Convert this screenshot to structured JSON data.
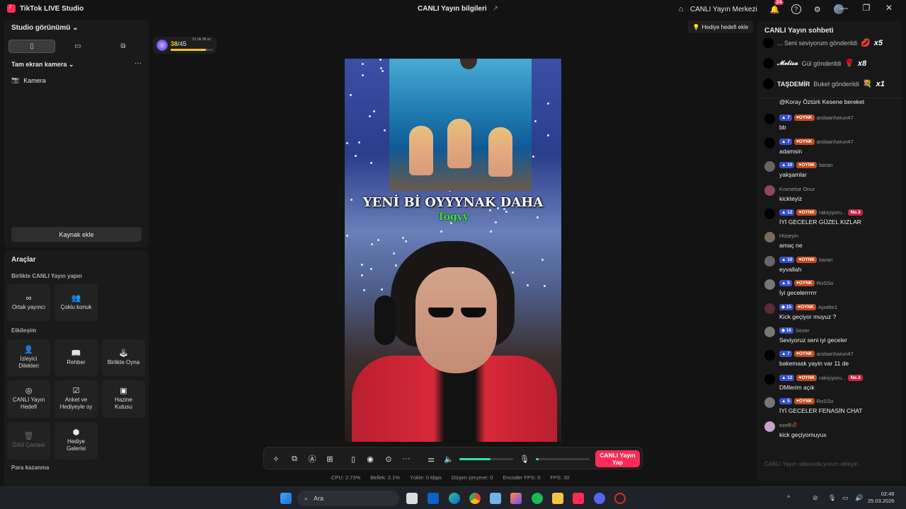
{
  "app": {
    "title": "TikTok LIVE Studio",
    "center_title": "CANLI Yayın bilgileri",
    "center_share_icon": "↗",
    "live_center": "CANLI Yayın Merkezi",
    "notification_count": "24",
    "help_glyph": "?",
    "window_min": "—",
    "window_max": "❐",
    "window_close": "✕"
  },
  "left": {
    "studio_view": "Studio görünümü",
    "camera_section": "Tam ekran kamera",
    "camera_item": "Kamera",
    "add_source": "Kaynak ekle"
  },
  "tools": {
    "title": "Araçlar",
    "sect_live_together": "Birlikte CANLI Yayın yapın",
    "co_host": "Ortak yayıncı",
    "multi_guest": "Çoklu konuk",
    "sect_interaction": "Etkileşim",
    "viewer_wishes": "İzleyici Dilekleri",
    "guide": "Rehber",
    "play_together": "Birlikte Oyna",
    "live_goal": "CANLI Yayın Hedefi",
    "poll": "Anket ve Hediyeyle oy",
    "treasure": "Hazine Kutusu",
    "reward_bag": "Ödül Çantası",
    "gift_gallery": "Hediye Galerisi",
    "sect_monetize": "Para kazanma"
  },
  "goal": {
    "current": "38",
    "total": "/45",
    "time": "51 dk 38 sn",
    "progress": 0.84
  },
  "gift_goal": "Hediye hedefi ekle",
  "preview": {
    "line1": "YENİ Bİ OYYYNAK DAHA",
    "line2": "Togyy"
  },
  "controls": {
    "volume_level": 0.58,
    "mic_level": 0.05,
    "go_live": "CANLI Yayın Yap"
  },
  "stats": {
    "cpu": "CPU:  2.73%",
    "mem": "Bellek:  2.1%",
    "upload": "Yükle:  0 kbps",
    "dropped": "Düşen çerçeve:  0",
    "encoder": "Encoder FPS:  0",
    "fps": "FPS:  30"
  },
  "chat": {
    "title": "CANLI Yayın sohbeti",
    "input_placeholder": "CANLI Yayın odasında yorum ekleyin",
    "gifts": [
      {
        "user": "",
        "action": "... Seni seviyorum gönderildi",
        "icon": "💋",
        "mult": "x5"
      },
      {
        "user": "𝓜𝓮𝓵𝓲𝓼𝓪",
        "action": "Gül gönderildi",
        "icon": "🌹",
        "mult": "x8"
      },
      {
        "user": "TAŞDEMİR",
        "action": "Buket gönderildi",
        "icon": "💐",
        "mult": "x1"
      }
    ],
    "messages": [
      {
        "user": "",
        "level": "",
        "fan": "",
        "rank": "",
        "text": "@Koray Öztürk Kesene bereket"
      },
      {
        "user": "arslaanharun47",
        "level": "▲ 7",
        "fan": "♥OYNK",
        "rank": "",
        "text": "bb"
      },
      {
        "user": "arslaanharun47",
        "level": "▲ 7",
        "fan": "♥OYNK",
        "rank": "",
        "text": "adamsin"
      },
      {
        "user": "baran",
        "level": "▲ 10",
        "fan": "♥OYNK",
        "rank": "",
        "text": "yakşamlar"
      },
      {
        "user": "Kısmetse Onur",
        "level": "",
        "fan": "",
        "rank": "",
        "text": "kickteyiz"
      },
      {
        "user": "rakiçiyoru...",
        "level": "▲ 12",
        "fan": "♥OYNK",
        "rank": "No.3",
        "text": "İYİ GECELER GÜZEL KIZLAR"
      },
      {
        "user": "Hüseyin",
        "level": "",
        "fan": "",
        "rank": "",
        "text": "amaç ne"
      },
      {
        "user": "baran",
        "level": "▲ 10",
        "fan": "♥OYNK",
        "rank": "",
        "text": "eyvallah"
      },
      {
        "user": "RoSSo",
        "level": "▲ 5",
        "fan": "♥OYNK",
        "rank": "",
        "text": "İyi gecelerrrrrr"
      },
      {
        "user": "Apotite1",
        "level": "◆ 15",
        "fan": "♥OYNK",
        "rank": "",
        "text": "Kick geçiyor muyuz ?"
      },
      {
        "user": "Sezer",
        "level": "◆ 16",
        "fan": "",
        "rank": "",
        "text": "Seviyoruz seni iyi geceler"
      },
      {
        "user": "arslaanharun47",
        "level": "▲ 7",
        "fan": "♥OYNK",
        "rank": "",
        "text": "bakemask yayin var 11 de"
      },
      {
        "user": "rakiçiyoru...",
        "level": "▲ 12",
        "fan": "♥OYNK",
        "rank": "No.3",
        "text": "DMlerim açık"
      },
      {
        "user": "RoSSo",
        "level": "▲ 5",
        "fan": "♥OYNK",
        "rank": "",
        "text": "İYİ GECELER FENASİN CHAT"
      },
      {
        "user": "ezelll🥀",
        "level": "",
        "fan": "",
        "rank": "",
        "text": "kick geçiyomuyux"
      }
    ]
  },
  "taskbar": {
    "search": "Ara",
    "time": "02:46",
    "date": "25.03.2026"
  }
}
